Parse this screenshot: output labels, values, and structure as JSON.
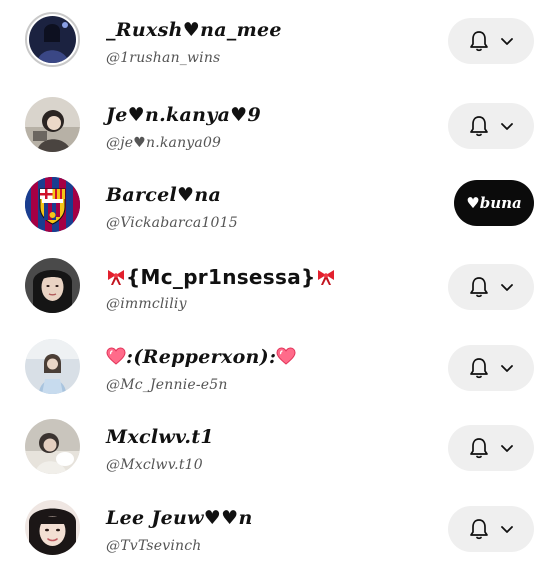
{
  "follow_list": {
    "rows": [
      {
        "display_name": "_Ruxsh♥na_mee",
        "handle": "@1rushan_wins",
        "action": "notifications"
      },
      {
        "display_name": "Je♥n.kanya♥9",
        "handle": "@je♥n.kanya09",
        "action": "notifications"
      },
      {
        "display_name": "Barcel♥na",
        "handle": "@Vickabarca1015",
        "action": "follow"
      },
      {
        "display_name": "{Mc_pr1nsessa}",
        "display_name_prefix_icon": "ribbon-icon",
        "display_name_suffix_icon": "ribbon-icon",
        "handle": "@immcliliy",
        "action": "notifications"
      },
      {
        "display_name": ":(Repperxon):",
        "display_name_prefix_icon": "sparkling-heart-icon",
        "display_name_suffix_icon": "sparkling-heart-icon",
        "handle": "@Mc_Jennie-e5n",
        "action": "notifications"
      },
      {
        "display_name": "Mxclwv.t1",
        "handle": "@Mxclwv.t10",
        "action": "notifications"
      },
      {
        "display_name": "Lee Jeuw♥♥n",
        "handle": "@TvTsevinch",
        "action": "notifications"
      }
    ],
    "follow_button_label": "♥buna",
    "notification_icon": "bell-icon",
    "dropdown_icon": "chevron-down-icon"
  },
  "colors": {
    "background": "#ffffff",
    "text_primary": "#111111",
    "text_secondary": "#555555",
    "notification_pill_bg": "#efefef",
    "follow_pill_bg": "#0b0b0b",
    "follow_pill_text": "#ffffff",
    "barcelona_blue": "#1a3d8f",
    "barcelona_red": "#a50044",
    "ribbon_red": "#e2202e",
    "heart_pink": "#ff6b8a"
  }
}
